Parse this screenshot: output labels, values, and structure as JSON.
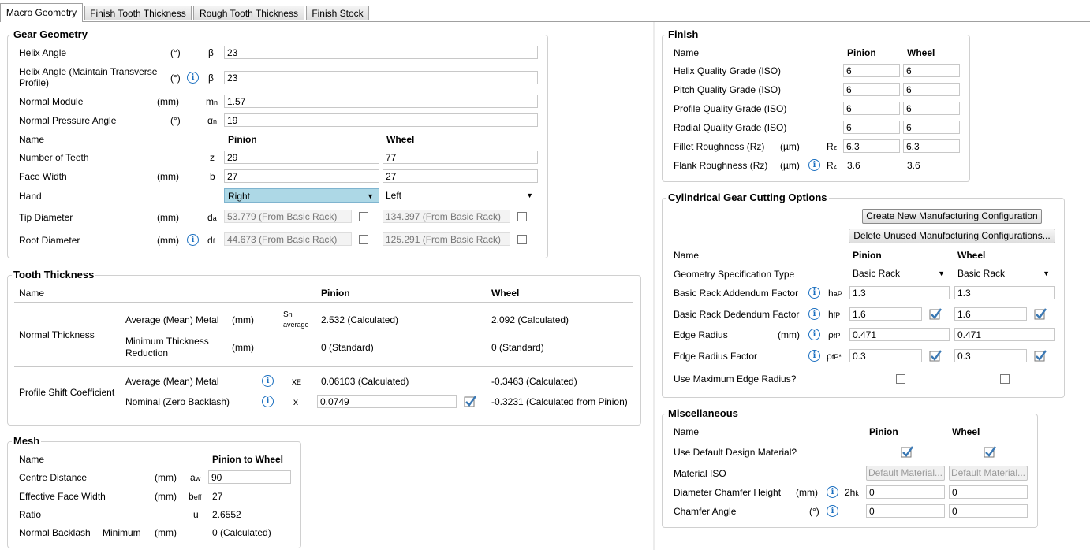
{
  "tabs": [
    "Macro Geometry",
    "Finish Tooth Thickness",
    "Rough Tooth Thickness",
    "Finish Stock"
  ],
  "gear_geometry": {
    "title": "Gear Geometry",
    "helix_angle": {
      "label": "Helix Angle",
      "unit": "(°)",
      "sym": "β",
      "value": "23"
    },
    "helix_angle_mtp": {
      "label": "Helix Angle (Maintain Transverse",
      "label2": "Profile)",
      "unit": "(°)",
      "sym": "β",
      "value": "23"
    },
    "normal_module": {
      "label": "Normal Module",
      "unit": "(mm)",
      "sym": "m",
      "sub": "n",
      "value": "1.57"
    },
    "normal_pressure_angle": {
      "label": "Normal Pressure Angle",
      "unit": "(°)",
      "sym": "α",
      "sub": "n",
      "value": "19"
    },
    "name_label": "Name",
    "pinion": "Pinion",
    "wheel": "Wheel",
    "number_of_teeth": {
      "label": "Number of Teeth",
      "sym": "z",
      "pinion": "29",
      "wheel": "77"
    },
    "face_width": {
      "label": "Face Width",
      "unit": "(mm)",
      "sym": "b",
      "pinion": "27",
      "wheel": "27"
    },
    "hand": {
      "label": "Hand",
      "pinion": "Right",
      "wheel": "Left"
    },
    "tip_diameter": {
      "label": "Tip Diameter",
      "unit": "(mm)",
      "sym": "d",
      "sub": "a",
      "pinion": "53.779 (From Basic Rack)",
      "wheel": "134.397 (From Basic Rack)"
    },
    "root_diameter": {
      "label": "Root Diameter",
      "unit": "(mm)",
      "sym": "d",
      "sub": "f",
      "pinion": "44.673 (From Basic Rack)",
      "wheel": "125.291 (From Basic Rack)"
    }
  },
  "tooth_thickness": {
    "title": "Tooth Thickness",
    "name_label": "Name",
    "pinion": "Pinion",
    "wheel": "Wheel",
    "normal_thickness": "Normal Thickness",
    "avg_metal": {
      "label": "Average (Mean) Metal",
      "unit": "(mm)",
      "sym": "S",
      "sub": "n",
      "sym2": "average",
      "pinion": "2.532 (Calculated)",
      "wheel": "2.092 (Calculated)"
    },
    "min_thickness": {
      "label": "Minimum Thickness",
      "label2": "Reduction",
      "unit": "(mm)",
      "pinion": "0 (Standard)",
      "wheel": "0 (Standard)"
    },
    "profile_shift": "Profile Shift Coefficient",
    "ps_avg": {
      "label": "Average (Mean) Metal",
      "sym": "x",
      "sub": "E",
      "pinion": "0.06103 (Calculated)",
      "wheel": "-0.3463 (Calculated)"
    },
    "ps_nominal": {
      "label": "Nominal (Zero Backlash)",
      "sym": "x",
      "pinion": "0.0749",
      "wheel": "-0.3231 (Calculated from Pinion)"
    }
  },
  "mesh": {
    "title": "Mesh",
    "name_label": "Name",
    "col": "Pinion to Wheel",
    "centre_distance": {
      "label": "Centre Distance",
      "unit": "(mm)",
      "sym": "a",
      "sub": "w",
      "value": "90"
    },
    "eff_face_width": {
      "label": "Effective Face Width",
      "unit": "(mm)",
      "sym": "b",
      "sub": "eff",
      "value": "27"
    },
    "ratio": {
      "label": "Ratio",
      "sym": "u",
      "value": "2.6552"
    },
    "normal_backlash": {
      "label": "Normal Backlash",
      "label2": "Minimum",
      "unit": "(mm)",
      "value": "0 (Calculated)"
    }
  },
  "finish": {
    "title": "Finish",
    "name_label": "Name",
    "pinion": "Pinion",
    "wheel": "Wheel",
    "helix_q": {
      "label": "Helix Quality Grade (ISO)",
      "pinion": "6",
      "wheel": "6"
    },
    "pitch_q": {
      "label": "Pitch Quality Grade (ISO)",
      "pinion": "6",
      "wheel": "6"
    },
    "profile_q": {
      "label": "Profile Quality Grade (ISO)",
      "pinion": "6",
      "wheel": "6"
    },
    "radial_q": {
      "label": "Radial Quality Grade (ISO)",
      "pinion": "6",
      "wheel": "6"
    },
    "fillet_r": {
      "label": "Fillet Roughness (Rz)",
      "unit": "(µm)",
      "sym": "R",
      "sub": "z",
      "pinion": "6.3",
      "wheel": "6.3"
    },
    "flank_r": {
      "label": "Flank Roughness (Rz)",
      "unit": "(µm)",
      "sym": "R",
      "sub": "z",
      "pinion": "3.6",
      "wheel": "3.6"
    }
  },
  "cutting": {
    "title": "Cylindrical Gear Cutting Options",
    "btn_create": "Create New Manufacturing Configuration",
    "btn_delete": "Delete Unused Manufacturing Configurations...",
    "name_label": "Name",
    "pinion": "Pinion",
    "wheel": "Wheel",
    "geom_spec": {
      "label": "Geometry Specification Type",
      "pinion": "Basic Rack",
      "wheel": "Basic Rack"
    },
    "addendum": {
      "label": "Basic Rack Addendum Factor",
      "sym": "h",
      "sub": "aP",
      "pinion": "1.3",
      "wheel": "1.3"
    },
    "dedendum": {
      "label": "Basic Rack Dedendum Factor",
      "sym": "h",
      "sub": "fP",
      "pinion": "1.6",
      "wheel": "1.6"
    },
    "edge_radius": {
      "label": "Edge Radius",
      "unit": "(mm)",
      "sym": "ρ",
      "sub": "fP",
      "pinion": "0.471",
      "wheel": "0.471"
    },
    "edge_radius_factor": {
      "label": "Edge Radius Factor",
      "sym": "ρ",
      "sub": "fP*",
      "pinion": "0.3",
      "wheel": "0.3"
    },
    "use_max": {
      "label": "Use Maximum Edge Radius?"
    }
  },
  "misc": {
    "title": "Miscellaneous",
    "name_label": "Name",
    "pinion": "Pinion",
    "wheel": "Wheel",
    "default_mat": {
      "label": "Use Default Design Material?"
    },
    "material_iso": {
      "label": "Material ISO",
      "pinion": "Default Material...",
      "wheel": "Default Material..."
    },
    "dia_chamfer": {
      "label": "Diameter Chamfer Height",
      "unit": "(mm)",
      "sym": "2h",
      "sub": "k",
      "pinion": "0",
      "wheel": "0"
    },
    "chamfer_angle": {
      "label": "Chamfer Angle",
      "unit": "(°)",
      "pinion": "0",
      "wheel": "0"
    }
  },
  "colors": {
    "accent": "#1a6fc0",
    "selection": "#add8e6",
    "check": "#3a78b4"
  }
}
